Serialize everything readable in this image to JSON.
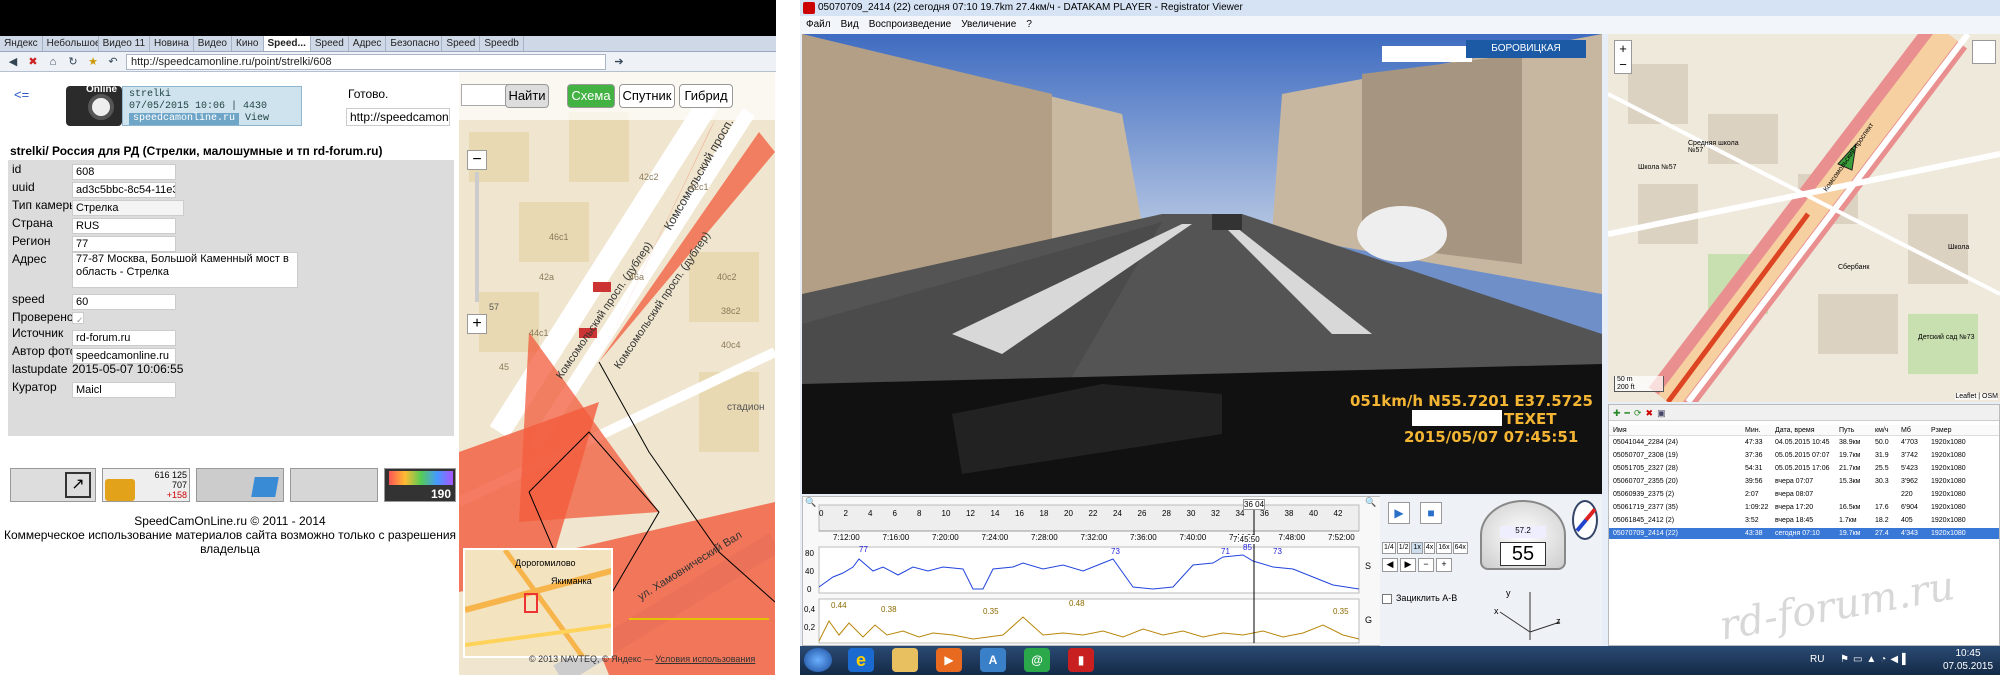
{
  "browser": {
    "tabs": [
      "Яндекс",
      "Небольшое",
      "Видео 11",
      "Новина",
      "Видео",
      "Кино",
      "Speed...",
      "Speed",
      "Адрес",
      "Безопасно",
      "Speed",
      "Speedb"
    ],
    "url": "http://speedcamonline.ru/point/strelki/608"
  },
  "page": {
    "back": "<=",
    "logo_text1": "strelki",
    "logo_text2": "07/05/2015 10:06 | 4430",
    "logo_site": "speedcamonline.ru",
    "logo_view": "View",
    "logo_online": "Online",
    "status": "Готово.",
    "status_url": "http://speedcamonli",
    "title": "strelki/ Россия для РД (Стрелки, малошумные и тп rd-forum.ru)",
    "fields": [
      {
        "label": "id",
        "value": "608"
      },
      {
        "label": "uuid",
        "value": "ad3c5bbc-8c54-11e3"
      },
      {
        "label": "Тип камеры",
        "value": "Стрелка"
      },
      {
        "label": "Страна",
        "value": "RUS"
      },
      {
        "label": "Регион",
        "value": "77"
      },
      {
        "label": "Адрес",
        "value": "77-87 Москва, Большой Каменный мост в область - Стрелка"
      },
      {
        "label": "speed",
        "value": "60"
      },
      {
        "label": "Проверено",
        "value": "✓"
      },
      {
        "label": "Источник",
        "value": "rd-forum.ru"
      },
      {
        "label": "Автор фото",
        "value": "speedcamonline.ru"
      },
      {
        "label": "lastupdate",
        "value": "2015-05-07 10:06:55"
      },
      {
        "label": "Куратор",
        "value": "Maicl"
      }
    ],
    "copyright": "SpeedCamOnLine.ru © 2011 - 2014",
    "copyright2": "Коммерческое использование материалов сайта возможно только с разрешения владельца",
    "banner_counts": [
      "616 125",
      "707",
      "+158"
    ],
    "banner_190": "190"
  },
  "map1": {
    "search_btn": "Найти",
    "btn_scheme": "Схема",
    "btn_sat": "Спутник",
    "btn_hybrid": "Гибрид",
    "street1": "Комсомольский просп. (дублер)",
    "street2": "Комсомольский просп.",
    "street3": "ул. Хамовнический Вал",
    "street4": "Комсомольский просп. (дублер)",
    "label_stadion": "стадион",
    "label_dorogo": "Дорогомилово",
    "label_yakim": "Якиманка",
    "copy": "© 2013 NAVTEQ, © Яндекс",
    "terms": "Условия использования",
    "labels_n": [
      "42c2",
      "46c1",
      "42a",
      "44c1",
      "42c1",
      "46a",
      "40c2",
      "38c2",
      "40c4",
      "57",
      "45"
    ]
  },
  "player": {
    "title": "05070709_2414 (22)   сегодня 07:10   19.7km   27.4км/ч  -  DATAKAM PLAYER - Registrator Viewer",
    "menu": [
      "Файл",
      "Вид",
      "Воспроизведение",
      "Увеличение",
      "?"
    ],
    "overlay1": "051km/h N55.7201 E37.5725",
    "overlay2": "TEXET",
    "overlay3": "2015/05/07 07:45:51",
    "sign": "БОРОВИЦКАЯ",
    "time_marks": [
      "7:12:00",
      "7:16:00",
      "7:20:00",
      "7:24:00",
      "7:28:00",
      "7:32:00",
      "7:36:00",
      "7:40:00",
      "7:44:00",
      "7:48:00",
      "7:52:00"
    ],
    "min_marks": [
      "0",
      "2",
      "4",
      "6",
      "8",
      "10",
      "12",
      "14",
      "16",
      "18",
      "20",
      "22",
      "24",
      "26",
      "28",
      "30",
      "32",
      "34",
      "36",
      "38",
      "40",
      "42"
    ],
    "cur_time": "7:45:50",
    "cur_min": "36 04",
    "speed_peaks": [
      "77",
      "73",
      "71",
      "85",
      "73"
    ],
    "g_peaks": [
      "0.44",
      "0.38",
      "0.35",
      "0.48",
      "0.35"
    ],
    "axis_s": "S",
    "axis_g": "G",
    "y80": "80",
    "y40": "40",
    "y0": "0",
    "g04": "0,4",
    "g02": "0,2",
    "speed_now": "55",
    "speed_dial": "57.2",
    "loop_label": "Зациклить A-B",
    "speed_btns": [
      "1/4",
      "1/2",
      "1x",
      "4x",
      "16x",
      "64x"
    ],
    "axes": [
      "x",
      "y",
      "z"
    ]
  },
  "rmap": {
    "scale1": "50 m",
    "scale2": "200 ft",
    "credit": "Leaflet | OSM",
    "labels": [
      "Школа №57",
      "Средняя школа №57",
      "Комсомольский проспект",
      "Детский сад №73",
      "Сбербанк",
      "Школа"
    ]
  },
  "files": {
    "headers": [
      "Имя",
      "Мин.",
      "Дата, время",
      "Путь",
      "км/ч",
      "Мб",
      "Рзмер"
    ],
    "rows": [
      [
        "05041044_2284 (24)",
        "47:33",
        "04.05.2015 10:45",
        "38.9км",
        "50.0",
        "4'703",
        "1920x1080"
      ],
      [
        "05050707_2308 (19)",
        "37:36",
        "05.05.2015 07:07",
        "19.7км",
        "31.9",
        "3'742",
        "1920x1080"
      ],
      [
        "05051705_2327 (28)",
        "54:31",
        "05.05.2015 17:06",
        "21.7км",
        "25.5",
        "5'423",
        "1920x1080"
      ],
      [
        "05060707_2355 (20)",
        "39:56",
        "вчера 07:07",
        "15.3км",
        "30.3",
        "3'962",
        "1920x1080"
      ],
      [
        "05060939_2375 (2)",
        "2:07",
        "вчера 08:07",
        "",
        "",
        "220",
        "1920x1080"
      ],
      [
        "05061719_2377 (35)",
        "1:09:22",
        "вчера 17:20",
        "16.5км",
        "17.6",
        "6'904",
        "1920x1080"
      ],
      [
        "05061845_2412 (2)",
        "3:52",
        "вчера 18:45",
        "1.7км",
        "18.2",
        "405",
        "1920x1080"
      ],
      [
        "05070709_2414 (22)",
        "43:38",
        "сегодня 07:10",
        "19.7км",
        "27.4",
        "4'343",
        "1920x1080"
      ]
    ]
  },
  "watermark": "rd-forum.ru",
  "taskbar": {
    "lang": "RU",
    "time": "10:45",
    "date": "07.05.2015"
  }
}
